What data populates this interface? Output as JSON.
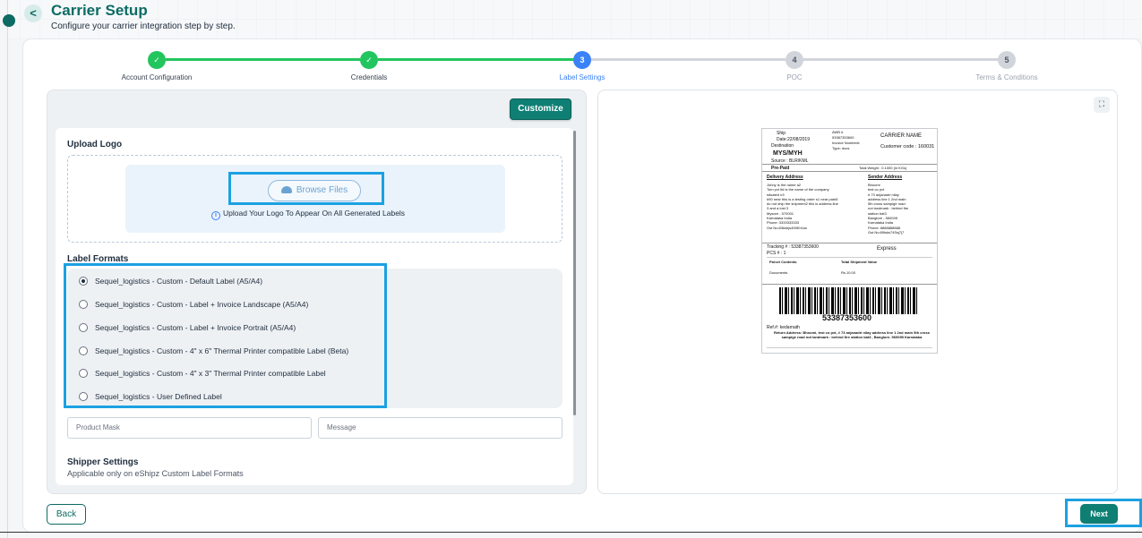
{
  "header": {
    "title": "Carrier Setup",
    "subtitle": "Configure your carrier integration step by step.",
    "back_icon": "<"
  },
  "stepper": {
    "steps": [
      {
        "number": "✓",
        "label": "Account Configuration",
        "status": "done"
      },
      {
        "number": "✓",
        "label": "Credentials",
        "status": "done"
      },
      {
        "number": "3",
        "label": "Label Settings",
        "status": "active"
      },
      {
        "number": "4",
        "label": "POC",
        "status": "todo"
      },
      {
        "number": "5",
        "label": "Terms & Conditions",
        "status": "todo"
      }
    ]
  },
  "left_panel": {
    "customize_label": "Customize",
    "upload_logo": {
      "heading": "Upload Logo",
      "browse_label": "Browse Files",
      "hint": "Upload Your Logo To Appear On All Generated Labels"
    },
    "label_formats": {
      "heading": "Label Formats",
      "options": [
        {
          "label": "Sequel_logistics - Custom - Default Label (A5/A4)",
          "selected": true
        },
        {
          "label": "Sequel_logistics - Custom - Label + Invoice Landscape (A5/A4)",
          "selected": false
        },
        {
          "label": "Sequel_logistics - Custom - Label + Invoice Portrait (A5/A4)",
          "selected": false
        },
        {
          "label": "Sequel_logistics - Custom - 4\" x 6\" Thermal Printer compatible Label (Beta)",
          "selected": false
        },
        {
          "label": "Sequel_logistics - Custom - 4\" x 3\" Thermal Printer compatible Label",
          "selected": false
        },
        {
          "label": "Sequel_logistics - User Defined Label",
          "selected": false
        }
      ]
    },
    "product_mask_placeholder": "Product Mask",
    "message_placeholder": "Message",
    "shipper_settings": {
      "heading": "Shipper Settings",
      "subtext": "Applicable only on eShipz Custom Label Formats"
    }
  },
  "preview": {
    "ship_date_label": "Ship",
    "ship_date": "Date:22/08/2019",
    "destination_label": "Destination",
    "destination": "MYS/MYH",
    "source": "Source : BLR/KML",
    "awb_label": "AWB #",
    "awb": "53387353600",
    "invoice_label": "Invoice Number#:",
    "type_label": "Type: docs",
    "carrier_name": "CARRIER NAME",
    "customer_code": "Customer code : 160031",
    "payment": "Pre-Paid",
    "total_weight": "Total Weight : 0.1000 (in KGs)",
    "delivery_heading": "Delivery Address",
    "delivery_lines": [
      "Johny is the name a2",
      "Tom pvt ltd is the name of the company",
      "situated n3",
      "#90 near this is a testing order s1 near park5",
      "do not ship the shipment2 this is address line",
      "3 and a lost 3",
      "Mysore - 570001",
      "Karnataka India",
      "Phone: 3333333333",
      "Gst No:83kshjs459Kh1ss"
    ],
    "sender_heading": "Sender Address",
    "sender_lines": [
      "Bhoomi",
      "test co pvt",
      "# 73 anjanadri nilay",
      "address line 1 2nd main",
      "5th cross sampige road",
      "not landmark : behind fire",
      "station bat3",
      "Banglore - 560095",
      "Karnataka India",
      "Phone: 8888888888",
      "Gst No:89lsks74Ssj7j7"
    ],
    "tracking": "Tracking # : 53387353600",
    "pcs": "PCS # : 1",
    "service": "Express",
    "parcel_contents_label": "Parcel Contents",
    "total_value_label": "Total Shipment Value",
    "parcel_contents": "Documents",
    "total_value": "Rs.10.00",
    "barcode_number": "53387353600",
    "ref": "Ref.#: kedarnath",
    "return_address": "Return Address: Bhoomi, test co pvt, # 73 anjanadri nilay address line 1 2nd main 5th cross sampige road not landmark : behind fire station bat3 , Banglore- 560095 Karnataka",
    "expand_icon": "⛶"
  },
  "footer": {
    "back_label": "Back",
    "next_label": "Next"
  },
  "colors": {
    "brand": "#0d6b63",
    "done": "#22c55e",
    "active": "#3b82f6",
    "highlight": "#1ba1e2"
  }
}
